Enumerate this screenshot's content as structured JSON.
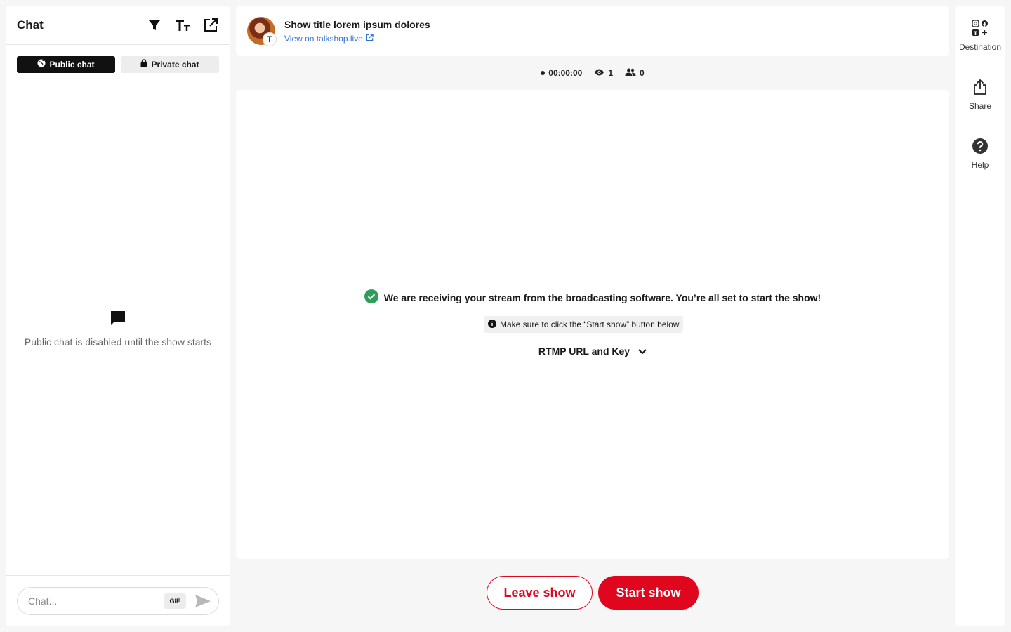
{
  "chat": {
    "title": "Chat",
    "tools": {
      "filter_icon": "filter-icon",
      "text_size_icon": "text-size-icon",
      "popout_icon": "external-open-icon"
    },
    "tabs": [
      {
        "label": "Public chat",
        "icon": "globe-icon",
        "active": true
      },
      {
        "label": "Private chat",
        "icon": "lock-icon",
        "active": false
      }
    ],
    "empty_state": {
      "icon": "chat-bubble-icon",
      "text": "Public chat is disabled until the show starts"
    },
    "input": {
      "placeholder": "Chat...",
      "value": "",
      "gif_label": "GIF",
      "send_icon": "send-icon"
    }
  },
  "show": {
    "title": "Show title lorem ipsum dolores",
    "link_text": "View on talkshop.live",
    "badge_letter": "T"
  },
  "stats": {
    "timer": "00:00:00",
    "viewers": "1",
    "participants": "0"
  },
  "stage": {
    "ready_message": "We are receiving your stream from the broadcasting software. You’re all set to start the show!",
    "hint": "Make sure to click the “Start show” button below",
    "rtmp_label": "RTMP URL and Key"
  },
  "actions": {
    "leave_label": "Leave show",
    "start_label": "Start show"
  },
  "rail": {
    "destination_label": "Destination",
    "share_label": "Share",
    "help_label": "Help"
  },
  "colors": {
    "accent": "#e0061e",
    "link": "#2f6fd6",
    "success": "#2e9e5b",
    "dark": "#111111"
  }
}
